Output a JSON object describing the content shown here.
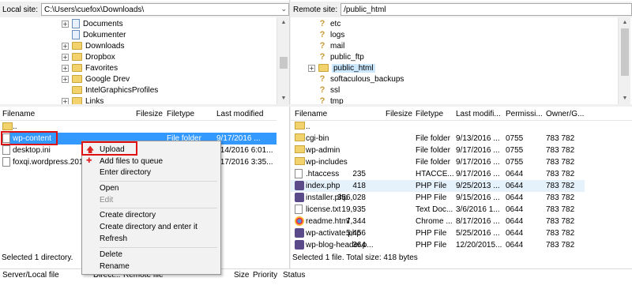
{
  "local": {
    "site_label": "Local site:",
    "site_path": "C:\\Users\\cuefox\\Downloads\\",
    "tree": [
      {
        "label": "Documents",
        "icon": "document-folder-icon",
        "expander": "+"
      },
      {
        "label": "Dokumenter",
        "icon": "document-folder-icon",
        "expander": ""
      },
      {
        "label": "Downloads",
        "icon": "download-folder-icon",
        "expander": "+"
      },
      {
        "label": "Dropbox",
        "icon": "folder-icon",
        "expander": "+"
      },
      {
        "label": "Favorites",
        "icon": "folder-icon",
        "expander": "+"
      },
      {
        "label": "Google Drev",
        "icon": "folder-icon",
        "expander": "+"
      },
      {
        "label": "IntelGraphicsProfiles",
        "icon": "folder-icon",
        "expander": ""
      },
      {
        "label": "Links",
        "icon": "folder-icon",
        "expander": "+"
      }
    ],
    "columns": [
      "Filename",
      "Filesize",
      "Filetype",
      "Last modified"
    ],
    "rows": [
      {
        "name": "..",
        "size": "",
        "type": "",
        "modified": ""
      },
      {
        "name": "wp-content",
        "size": "",
        "type": "File folder",
        "modified": "9/17/2016 ..."
      },
      {
        "name": "desktop.ini",
        "size": "",
        "type": "",
        "modified": "/14/2016 6:01..."
      },
      {
        "name": "foxqi.wordpress.2016",
        "size": "",
        "type": "",
        "modified": "/17/2016 3:35..."
      }
    ],
    "status": "Selected 1 directory."
  },
  "remote": {
    "site_label": "Remote site:",
    "site_path": "/public_html",
    "tree": [
      {
        "label": "etc",
        "expander": ""
      },
      {
        "label": "logs",
        "expander": ""
      },
      {
        "label": "mail",
        "expander": ""
      },
      {
        "label": "public_ftp",
        "expander": ""
      },
      {
        "label": "public_html",
        "expander": "+"
      },
      {
        "label": "softaculous_backups",
        "expander": ""
      },
      {
        "label": "ssl",
        "expander": ""
      },
      {
        "label": "tmp",
        "expander": ""
      }
    ],
    "columns": [
      "Filename",
      "Filesize",
      "Filetype",
      "Last modifi...",
      "Permissi...",
      "Owner/G..."
    ],
    "rows": [
      {
        "name": "..",
        "size": "",
        "type": "",
        "modified": "",
        "perm": "",
        "owner": "",
        "icon": "folder"
      },
      {
        "name": "cgi-bin",
        "size": "",
        "type": "File folder",
        "modified": "9/13/2016 ...",
        "perm": "0755",
        "owner": "783 782",
        "icon": "folder"
      },
      {
        "name": "wp-admin",
        "size": "",
        "type": "File folder",
        "modified": "9/17/2016 ...",
        "perm": "0755",
        "owner": "783 782",
        "icon": "folder"
      },
      {
        "name": "wp-includes",
        "size": "",
        "type": "File folder",
        "modified": "9/17/2016 ...",
        "perm": "0755",
        "owner": "783 782",
        "icon": "folder"
      },
      {
        "name": ".htaccess",
        "size": "235",
        "type": "HTACCE...",
        "modified": "9/17/2016 ...",
        "perm": "0644",
        "owner": "783 782",
        "icon": "doc"
      },
      {
        "name": "index.php",
        "size": "418",
        "type": "PHP File",
        "modified": "9/25/2013 ...",
        "perm": "0644",
        "owner": "783 782",
        "icon": "php"
      },
      {
        "name": "installer.php",
        "size": "356,028",
        "type": "PHP File",
        "modified": "9/15/2016 ...",
        "perm": "0644",
        "owner": "783 782",
        "icon": "php"
      },
      {
        "name": "license.txt",
        "size": "19,935",
        "type": "Text Doc...",
        "modified": "3/6/2016 1...",
        "perm": "0644",
        "owner": "783 782",
        "icon": "doc"
      },
      {
        "name": "readme.html",
        "size": "7,344",
        "type": "Chrome ...",
        "modified": "8/17/2016 ...",
        "perm": "0644",
        "owner": "783 782",
        "icon": "chrome"
      },
      {
        "name": "wp-activate.php",
        "size": "5,456",
        "type": "PHP File",
        "modified": "5/25/2016 ...",
        "perm": "0644",
        "owner": "783 782",
        "icon": "php"
      },
      {
        "name": "wp-blog-header.p...",
        "size": "364",
        "type": "PHP File",
        "modified": "12/20/2015...",
        "perm": "0644",
        "owner": "783 782",
        "icon": "php"
      }
    ],
    "status": "Selected 1 file. Total size: 418 bytes"
  },
  "context_menu": {
    "items": [
      {
        "label": "Upload",
        "disabled": false,
        "icon": "upload-arrow-icon"
      },
      {
        "label": "Add files to queue",
        "disabled": false,
        "icon": "add-queue-icon"
      },
      {
        "label": "Enter directory",
        "disabled": false
      },
      {
        "label": "Open",
        "disabled": false
      },
      {
        "label": "Edit",
        "disabled": true
      },
      {
        "label": "Create directory",
        "disabled": false
      },
      {
        "label": "Create directory and enter it",
        "disabled": false
      },
      {
        "label": "Refresh",
        "disabled": false
      },
      {
        "label": "Delete",
        "disabled": false
      },
      {
        "label": "Rename",
        "disabled": false
      }
    ]
  },
  "queue": {
    "columns": [
      "Server/Local file",
      "Direct...",
      "Remote file",
      "Size",
      "Priority",
      "Status"
    ]
  },
  "colors": {
    "selection": "#3399ff",
    "highlight_row": "#e5f1fb",
    "annotation": "#dd1111"
  }
}
